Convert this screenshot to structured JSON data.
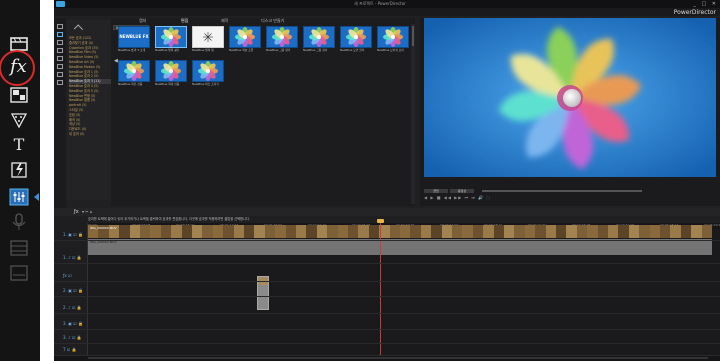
{
  "side_toolbar": {
    "items": [
      "media-room-icon",
      "fx-room-icon",
      "pip-room-icon",
      "particle-room-icon",
      "title-room-icon",
      "transition-room-icon",
      "audio-mix-room-icon",
      "voice-over-icon",
      "chapter-room-icon",
      "subtitle-room-icon"
    ],
    "fx_label": "fx",
    "highlight_color": "#d92a2a"
  },
  "app": {
    "window_title": "새 프로젝트 - PowerDirector",
    "window_buttons": "_ □ ✕",
    "brand": "PowerDirector"
  },
  "library": {
    "tabs": [
      {
        "label": "캡처",
        "active": false
      },
      {
        "label": "편집",
        "active": true
      },
      {
        "label": "제작",
        "active": false
      },
      {
        "label": "디스크 만들기",
        "active": false
      }
    ],
    "dropdown": "NewBlue 효과 3",
    "search": "⌕ ≡ ⊞ ⌄",
    "categories": [
      "모든 효과 (122)",
      "즐겨찾기 효과 (0)",
      "Cyberlink 효과 (35)",
      "NewBlue Film (5)",
      "NewBlue Video (5)",
      "NewBlue Art (5)",
      "NewBlue Motion (5)",
      "NewBlue 효과 1 (5)",
      "NewBlue 효과 2 (5)",
      "NewBlue 효과 3 (11)",
      "NewBlue 효과 4 (5)",
      "NewBlue 효과 5 (5)",
      "NewBlue 변형 (5)",
      "NewBlue 필름 (5)",
      "portrait (5)",
      "스타일 (5)",
      "흐림 (5)",
      "왜곡 (5)",
      "색상 (5)",
      "다운로드 (0)",
      "내 효과 (0)"
    ],
    "selected_category_index": 9,
    "thumbnails": [
      {
        "label": "NewBlue 효과 3 소개",
        "style": "logo"
      },
      {
        "label": "NewBlue 빛의 광선",
        "style": "flower"
      },
      {
        "label": "NewBlue 빛의 벗",
        "style": "white"
      },
      {
        "label": "NewBlue 색상 조절",
        "style": "flower"
      },
      {
        "label": "NewBlue 그림 양각",
        "style": "flower"
      },
      {
        "label": "NewBlue 그림 점각",
        "style": "flower"
      },
      {
        "label": "NewBlue 모션 블러",
        "style": "flower"
      },
      {
        "label": "NewBlue 브러쉬 브이",
        "style": "flower"
      },
      {
        "label": "NewBlue 회전 잡음",
        "style": "flower"
      },
      {
        "label": "NewBlue 최대 잡음",
        "style": "flower"
      },
      {
        "label": "NewBlue 비트 조각기",
        "style": "flower"
      }
    ],
    "logo_text": "NEWBLUE FX"
  },
  "preview": {
    "btn_clip": "클립",
    "btn_movie": "동영상",
    "tools": "◀ ▶ ■ ◀◀ ▶▶ ⏮ ⏭ 🔊 ⛶"
  },
  "timeline": {
    "toolbar_fx": "ƒx",
    "toolbar_more": "▾ ✂ ⌂",
    "hint": "효과를 트랙에 끌어다 놓아 추가하거나 트랙을 클릭하여 효과를 편집합니다. 이곳에 효과를 적용하려면 클립을 선택합니다.",
    "ruler_ticks": [
      "00;00",
      "00;00;24;08",
      "00;00;48;16",
      "00;01;12;24",
      "00;01;37;02",
      "00;02;01;10",
      "00;02;25;18",
      "00;02;49;26",
      "00;03;14;04",
      "00;03;38;12",
      "00;04;02;20",
      "00;04;26;28",
      "00;04;51;06",
      "00;05;15;14",
      "00;05;39;22"
    ],
    "tracks": [
      {
        "label": "1. ▣ ☑ 🔒"
      },
      {
        "label": "1. ♪ ☑ 🔒"
      },
      {
        "label": "ƒx ☑"
      },
      {
        "label": "2. ▣ ☑ 🔒"
      },
      {
        "label": "2. ♪ ☑ 🔒"
      },
      {
        "label": "3. ▣ ☑ 🔒"
      },
      {
        "label": "3. ♪ ☑ 🔒"
      },
      {
        "label": "T ☑ 🔒"
      },
      {
        "label": "♫ ☑ 🔒"
      }
    ],
    "video_clip_label": "IMG_000000.MOV",
    "audio_clip_label": "IMG_000000.MOV"
  }
}
